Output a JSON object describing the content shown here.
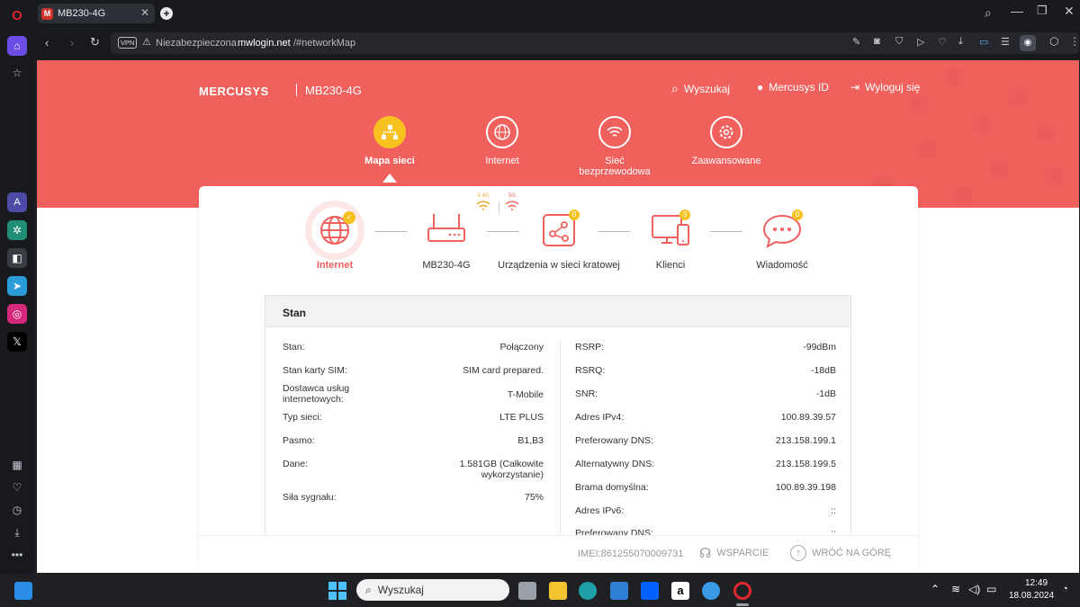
{
  "browser": {
    "tab_title": "MB230-4G",
    "tab_favicon": "M",
    "vpn_label": "VPN",
    "security_text": "Niezabezpieczona",
    "url_host": "mwlogin.net",
    "url_path": "/#networkMap"
  },
  "header": {
    "brand": "MERCUSYS",
    "model": "MB230-4G",
    "search_label": "Wyszukaj",
    "mercusys_id_label": "Mercusys ID",
    "logout_label": "Wyloguj się"
  },
  "nav": {
    "network_map": "Mapa sieci",
    "internet": "Internet",
    "wireless_line1": "Sieć",
    "wireless_line2": "bezprzewodowa",
    "advanced": "Zaawansowane"
  },
  "topology": {
    "internet": "Internet",
    "router": "MB230-4G",
    "band_24": "2.4G",
    "band_5": "5G",
    "mesh": "Urządzenia w sieci kratowej",
    "mesh_count": "0",
    "clients": "Klienci",
    "clients_count": "3",
    "messages": "Wiadomość",
    "messages_count": "0"
  },
  "status": {
    "title": "Stan",
    "left": [
      {
        "label": "Stan:",
        "value": "Połączony"
      },
      {
        "label": "Stan karty SIM:",
        "value": "SIM card prepared."
      },
      {
        "label": "Dostawca usług internetowych:",
        "value": "T-Mobile"
      },
      {
        "label": "Typ sieci:",
        "value": "LTE PLUS"
      },
      {
        "label": "Pasmo:",
        "value": "B1,B3"
      },
      {
        "label": "Dane:",
        "value": "1.581GB (Całkowite wykorzystanie)"
      },
      {
        "label": "Siła sygnału:",
        "value": "75%"
      }
    ],
    "right": [
      {
        "label": "RSRP:",
        "value": "-99dBm"
      },
      {
        "label": "RSRQ:",
        "value": "-18dB"
      },
      {
        "label": "SNR:",
        "value": "-1dB"
      },
      {
        "label": "Adres IPv4:",
        "value": "100.89.39.57"
      },
      {
        "label": "Preferowany DNS:",
        "value": "213.158.199.1"
      },
      {
        "label": "Alternatywny DNS:",
        "value": "213.158.199.5"
      },
      {
        "label": "Brama domyślna:",
        "value": "100.89.39.198"
      },
      {
        "label": "Adres IPv6:",
        "value": "::"
      },
      {
        "label": "Preferowany DNS:",
        "value": "::"
      }
    ]
  },
  "footer": {
    "imei": "IMEI:861255070009731",
    "support": "WSPARCIE",
    "back_to_top": "WRÓĆ NA GÓRĘ"
  },
  "taskbar": {
    "search_placeholder": "Wyszukaj",
    "time": "12:49",
    "date": "18.08.2024"
  },
  "colors": {
    "brand_red": "#f0615e",
    "accent_yellow": "#f7c21f"
  }
}
